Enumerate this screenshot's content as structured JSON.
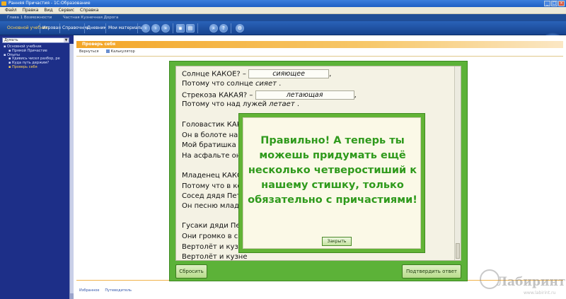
{
  "window": {
    "title": "Ранняя Причастия - 1С:Образование"
  },
  "menubar": {
    "items": [
      "Файл",
      "Правка",
      "Вид",
      "Сервис",
      "Справка"
    ]
  },
  "header": {
    "left": "Глава 1 Возможности",
    "right": "Частная Кузнечная Дорога"
  },
  "toolbar": {
    "tabs": [
      {
        "label": "Основной учебник",
        "active": true
      },
      {
        "label": "Игровая",
        "active": false
      },
      {
        "label": "Справочник",
        "active": false
      },
      {
        "label": "Дневник",
        "active": false
      },
      {
        "label": "Мои материалы",
        "active": false
      }
    ],
    "icons": [
      "back-icon",
      "forward-icon",
      "next-icon",
      "bookmark-icon",
      "print-icon",
      "search-icon",
      "help-icon",
      "settings-icon"
    ]
  },
  "sidebar": {
    "select_value": "Думать",
    "tree": [
      {
        "label": "Основной учебник",
        "level": 1,
        "selected": false
      },
      {
        "label": "Прямой Причастие",
        "level": 2,
        "selected": false
      },
      {
        "label": "Опыты",
        "level": 1,
        "selected": false
      },
      {
        "label": "Удивись чисел разбор, ре",
        "level": 2,
        "selected": false
      },
      {
        "label": "Куда путь держим?",
        "level": 2,
        "selected": false
      },
      {
        "label": "Проверь себя",
        "level": 2,
        "selected": true
      }
    ]
  },
  "content": {
    "section_title": "Проверь себя",
    "tools": [
      "Вернуться",
      "Калькулятор"
    ],
    "footer_links": [
      "Избранное",
      "Путеводитель"
    ]
  },
  "worksheet": {
    "lines": [
      {
        "text": "Солнце КАКОЕ? – ",
        "answer_box": "сияющее",
        "after": ","
      },
      {
        "text": "Потому что солнце ",
        "answer_inline": "сияет",
        "after": " ."
      },
      {
        "text": "Стрекоза КАКАЯ? – ",
        "answer_box": "летающая",
        "after": ","
      },
      {
        "text": "Потому что над лужей ",
        "answer_inline": "летает",
        "after": " ."
      },
      {
        "text": ""
      },
      {
        "text": "Головастик КАКО"
      },
      {
        "text": "Он в болоте на ко"
      },
      {
        "text": "Мой братишка Во"
      },
      {
        "text": "На асфальте он н"
      },
      {
        "text": ""
      },
      {
        "text": "Младенец КАКОЙ"
      },
      {
        "text": "Потому что в кол"
      },
      {
        "text": "Сосед дядя Петя"
      },
      {
        "text": "Он песню младен"
      },
      {
        "text": ""
      },
      {
        "text": "Гусаки дяди Пети"
      },
      {
        "text": "Они громко в сар"
      },
      {
        "text": "Вертолёт и кузне"
      },
      {
        "text": "Вертолёт и кузне"
      }
    ],
    "reset_button": "Сбросить",
    "confirm_button": "Подтвердить ответ"
  },
  "modal": {
    "message": "Правильно! А теперь ты можешь придумать ещё несколько четверостиший к нашему стишку, только обязательно с причастиями!",
    "close_button": "Закрыть"
  },
  "watermark": {
    "brand": "Лабиринт",
    "url": "www.labirint.ru"
  }
}
